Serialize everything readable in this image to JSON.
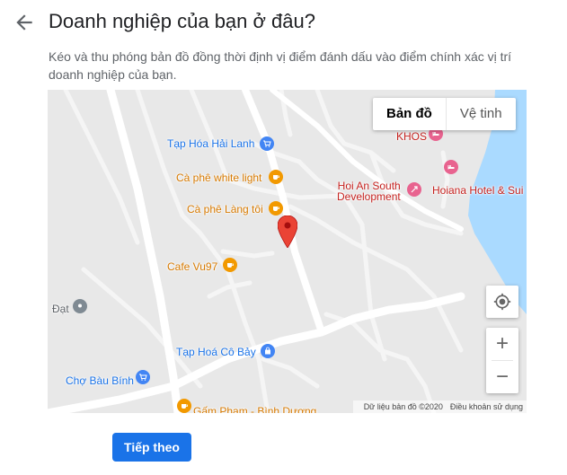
{
  "header": {
    "back_icon": "arrow-back-icon",
    "title": "Doanh nghiệp của bạn ở đâu?",
    "description": "Kéo và thu phóng bản đồ đồng thời định vị điểm đánh dấu vào điểm chính xác vị trí doanh nghiệp của bạn."
  },
  "map": {
    "type_toggle": {
      "map_label": "Bản đồ",
      "satellite_label": "Vệ tinh",
      "selected": "Bản đồ"
    },
    "places": [
      {
        "label": "Tạp Hóa Hải Lanh",
        "icon": "shopping-cart-icon",
        "color": "#4285f4"
      },
      {
        "label": "Cà phê white light",
        "icon": "coffee-icon",
        "color": "#f29900"
      },
      {
        "label": "Cà phê Làng tôi",
        "icon": "coffee-icon",
        "color": "#f29900"
      },
      {
        "label": "Cafe Vu97",
        "icon": "coffee-icon",
        "color": "#f29900"
      },
      {
        "label": "Đạt",
        "icon": "pin-icon",
        "color": "#7f8a93"
      },
      {
        "label": "Tạp Hoá Cô Bảy",
        "icon": "shopping-bag-icon",
        "color": "#4285f4"
      },
      {
        "label": "Chợ Bàu Bính",
        "icon": "shopping-cart-icon",
        "color": "#4285f4"
      },
      {
        "label": "Gấm Phạm - Bình Dương",
        "icon": "coffee-icon",
        "color": "#f29900"
      },
      {
        "label": "KHOS",
        "icon": "hotel-icon",
        "color": "#e8638f"
      },
      {
        "label": "Hoi An South\nDevelopment",
        "icon": "map-pin-icon",
        "color": "#e8638f"
      },
      {
        "label": "Hoiana Hotel & Sui",
        "icon": "hotel-icon",
        "color": "#e8638f"
      }
    ],
    "controls": {
      "locate_icon": "my-location-icon",
      "zoom_in": "+",
      "zoom_out": "−"
    },
    "attribution": {
      "data": "Dữ liệu bản đồ ©2020",
      "terms": "Điều khoản sử dụng"
    },
    "marker_icon": "red-pin-icon",
    "water_color": "#aadaff"
  },
  "footer": {
    "next_label": "Tiếp theo",
    "accent_color": "#1a73e8"
  }
}
